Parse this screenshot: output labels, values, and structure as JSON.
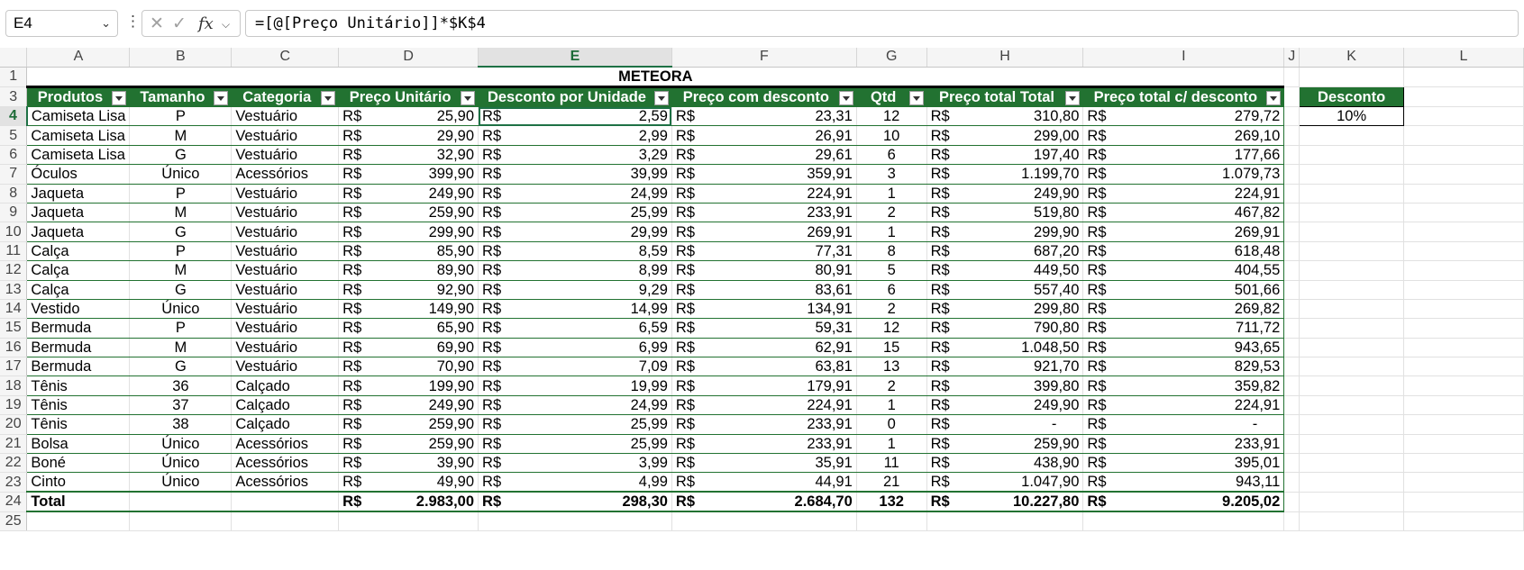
{
  "formula_bar": {
    "name_box": "E4",
    "formula": "=[@[Preço Unitário]]*$K$4"
  },
  "icons": {
    "chevron": "chevron-down-icon",
    "more": "more-vertical-icon",
    "cancel": "close-icon",
    "confirm": "check-icon",
    "fx": "function-icon"
  },
  "columns": [
    "A",
    "B",
    "C",
    "D",
    "E",
    "F",
    "G",
    "H",
    "I",
    "J",
    "K",
    "L"
  ],
  "title": "METEORA",
  "headers": [
    "Produtos",
    "Tamanho",
    "Categoria",
    "Preço Unitário",
    "Desconto por Unidade",
    "Preço com desconto",
    "Qtd",
    "Preço total Total",
    "Preço total c/ desconto"
  ],
  "currency": "R$",
  "rows": [
    {
      "row": "4",
      "p": "Camiseta Lisa",
      "t": "P",
      "c": "Vestuário",
      "pu": "25,90",
      "du": "2,59",
      "pd": "23,31",
      "q": "12",
      "pt": "310,80",
      "ptd": "279,72"
    },
    {
      "row": "5",
      "p": "Camiseta Lisa",
      "t": "M",
      "c": "Vestuário",
      "pu": "29,90",
      "du": "2,99",
      "pd": "26,91",
      "q": "10",
      "pt": "299,00",
      "ptd": "269,10"
    },
    {
      "row": "6",
      "p": "Camiseta Lisa",
      "t": "G",
      "c": "Vestuário",
      "pu": "32,90",
      "du": "3,29",
      "pd": "29,61",
      "q": "6",
      "pt": "197,40",
      "ptd": "177,66"
    },
    {
      "row": "7",
      "p": "Óculos",
      "t": "Único",
      "c": "Acessórios",
      "pu": "399,90",
      "du": "39,99",
      "pd": "359,91",
      "q": "3",
      "pt": "1.199,70",
      "ptd": "1.079,73"
    },
    {
      "row": "8",
      "p": "Jaqueta",
      "t": "P",
      "c": "Vestuário",
      "pu": "249,90",
      "du": "24,99",
      "pd": "224,91",
      "q": "1",
      "pt": "249,90",
      "ptd": "224,91"
    },
    {
      "row": "9",
      "p": "Jaqueta",
      "t": "M",
      "c": "Vestuário",
      "pu": "259,90",
      "du": "25,99",
      "pd": "233,91",
      "q": "2",
      "pt": "519,80",
      "ptd": "467,82"
    },
    {
      "row": "10",
      "p": "Jaqueta",
      "t": "G",
      "c": "Vestuário",
      "pu": "299,90",
      "du": "29,99",
      "pd": "269,91",
      "q": "1",
      "pt": "299,90",
      "ptd": "269,91"
    },
    {
      "row": "11",
      "p": "Calça",
      "t": "P",
      "c": "Vestuário",
      "pu": "85,90",
      "du": "8,59",
      "pd": "77,31",
      "q": "8",
      "pt": "687,20",
      "ptd": "618,48"
    },
    {
      "row": "12",
      "p": "Calça",
      "t": "M",
      "c": "Vestuário",
      "pu": "89,90",
      "du": "8,99",
      "pd": "80,91",
      "q": "5",
      "pt": "449,50",
      "ptd": "404,55"
    },
    {
      "row": "13",
      "p": "Calça",
      "t": "G",
      "c": "Vestuário",
      "pu": "92,90",
      "du": "9,29",
      "pd": "83,61",
      "q": "6",
      "pt": "557,40",
      "ptd": "501,66"
    },
    {
      "row": "14",
      "p": "Vestido",
      "t": "Único",
      "c": "Vestuário",
      "pu": "149,90",
      "du": "14,99",
      "pd": "134,91",
      "q": "2",
      "pt": "299,80",
      "ptd": "269,82"
    },
    {
      "row": "15",
      "p": "Bermuda",
      "t": "P",
      "c": "Vestuário",
      "pu": "65,90",
      "du": "6,59",
      "pd": "59,31",
      "q": "12",
      "pt": "790,80",
      "ptd": "711,72"
    },
    {
      "row": "16",
      "p": "Bermuda",
      "t": "M",
      "c": "Vestuário",
      "pu": "69,90",
      "du": "6,99",
      "pd": "62,91",
      "q": "15",
      "pt": "1.048,50",
      "ptd": "943,65"
    },
    {
      "row": "17",
      "p": "Bermuda",
      "t": "G",
      "c": "Vestuário",
      "pu": "70,90",
      "du": "7,09",
      "pd": "63,81",
      "q": "13",
      "pt": "921,70",
      "ptd": "829,53"
    },
    {
      "row": "18",
      "p": "Tênis",
      "t": "36",
      "c": "Calçado",
      "pu": "199,90",
      "du": "19,99",
      "pd": "179,91",
      "q": "2",
      "pt": "399,80",
      "ptd": "359,82"
    },
    {
      "row": "19",
      "p": "Tênis",
      "t": "37",
      "c": "Calçado",
      "pu": "249,90",
      "du": "24,99",
      "pd": "224,91",
      "q": "1",
      "pt": "249,90",
      "ptd": "224,91"
    },
    {
      "row": "20",
      "p": "Tênis",
      "t": "38",
      "c": "Calçado",
      "pu": "259,90",
      "du": "25,99",
      "pd": "233,91",
      "q": "0",
      "pt": "-",
      "ptd": "-"
    },
    {
      "row": "21",
      "p": "Bolsa",
      "t": "Único",
      "c": "Acessórios",
      "pu": "259,90",
      "du": "25,99",
      "pd": "233,91",
      "q": "1",
      "pt": "259,90",
      "ptd": "233,91"
    },
    {
      "row": "22",
      "p": "Boné",
      "t": "Único",
      "c": "Acessórios",
      "pu": "39,90",
      "du": "3,99",
      "pd": "35,91",
      "q": "11",
      "pt": "438,90",
      "ptd": "395,01"
    },
    {
      "row": "23",
      "p": "Cinto",
      "t": "Único",
      "c": "Acessórios",
      "pu": "49,90",
      "du": "4,99",
      "pd": "44,91",
      "q": "21",
      "pt": "1.047,90",
      "ptd": "943,11"
    }
  ],
  "total": {
    "row": "24",
    "label": "Total",
    "pu": "2.983,00",
    "du": "298,30",
    "pd": "2.684,70",
    "q": "132",
    "pt": "10.227,80",
    "ptd": "9.205,02"
  },
  "discount": {
    "label": "Desconto",
    "value": "10%"
  },
  "row_numbers": {
    "r1": "1",
    "r3": "3",
    "r25": "25"
  },
  "accent_color": "#227231"
}
